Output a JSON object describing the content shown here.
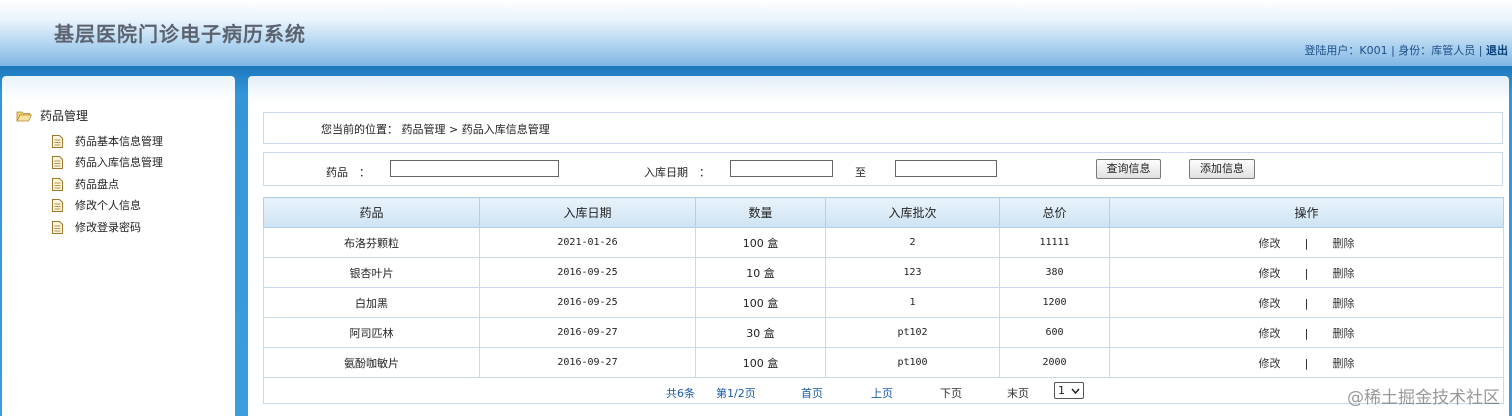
{
  "header": {
    "title": "基层医院门诊电子病历系统",
    "user_info": "登陆用户：K001 | 身份：库管人员 |",
    "logout": "退出"
  },
  "sidebar": {
    "group": "药品管理",
    "items": [
      {
        "label": "药品基本信息管理"
      },
      {
        "label": "药品入库信息管理"
      },
      {
        "label": "药品盘点"
      },
      {
        "label": "修改个人信息"
      },
      {
        "label": "修改登录密码"
      }
    ]
  },
  "breadcrumb": {
    "prefix": "您当前的位置：",
    "path": "药品管理 > 药品入库信息管理"
  },
  "search": {
    "drug_label": "药品　：",
    "drug_value": "",
    "date_label": "入库日期　：",
    "date_from": "",
    "to_label": "至",
    "date_to": "",
    "query_button": "查询信息",
    "add_button": "添加信息"
  },
  "table": {
    "headers": [
      "药品",
      "入库日期",
      "数量",
      "入库批次",
      "总价",
      "操作"
    ],
    "rows": [
      {
        "drug": "布洛芬颗粒",
        "date": "2021-01-26",
        "qty": "100 盒",
        "batch": "2",
        "total": "11111"
      },
      {
        "drug": "银杏叶片",
        "date": "2016-09-25",
        "qty": "10 盒",
        "batch": "123",
        "total": "380"
      },
      {
        "drug": "白加黑",
        "date": "2016-09-25",
        "qty": "100 盒",
        "batch": "1",
        "total": "1200"
      },
      {
        "drug": "阿司匹林",
        "date": "2016-09-27",
        "qty": "30 盒",
        "batch": "pt102",
        "total": "600"
      },
      {
        "drug": "氨酚咖敏片",
        "date": "2016-09-27",
        "qty": "100 盒",
        "batch": "pt100",
        "total": "2000"
      }
    ],
    "edit_label": "修改",
    "sep": "|",
    "delete_label": "删除"
  },
  "pager": {
    "total": "共6条",
    "page": "第1/2页",
    "first": "首页",
    "prev": "上页",
    "next": "下页",
    "last": "末页",
    "select_value": "1"
  },
  "watermark": "@稀土掘金技术社区"
}
